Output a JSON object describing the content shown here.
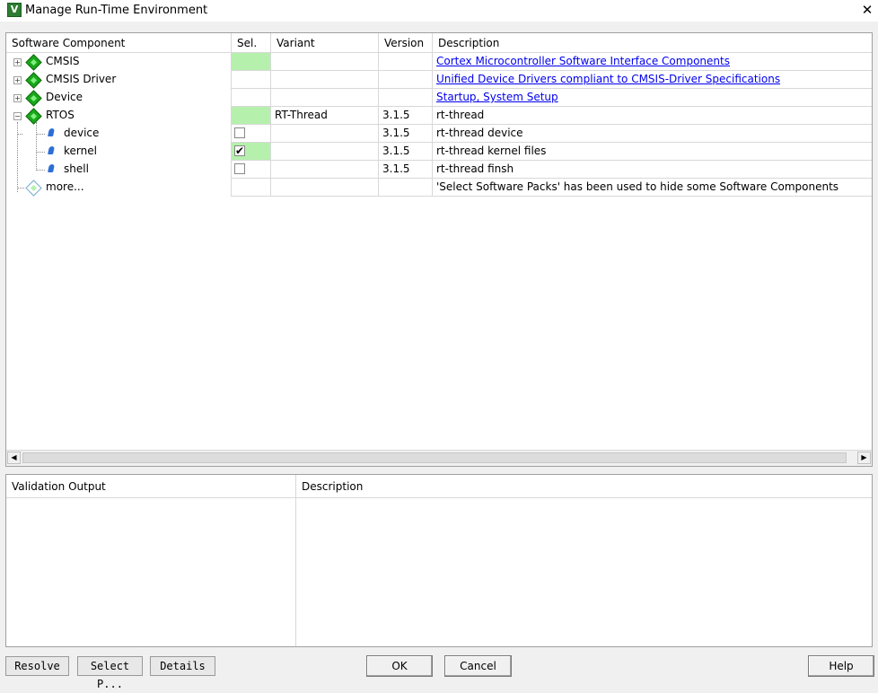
{
  "window": {
    "title": "Manage Run-Time Environment",
    "app_icon": "V",
    "close_glyph": "✕"
  },
  "table": {
    "headers": {
      "component": "Software Component",
      "sel": "Sel.",
      "variant": "Variant",
      "version": "Version",
      "description": "Description"
    },
    "rows": [
      {
        "component": "CMSIS",
        "variant": "",
        "version": "",
        "description": "Cortex Microcontroller Software Interface Components"
      },
      {
        "component": "CMSIS Driver",
        "variant": "",
        "version": "",
        "description": "Unified Device Drivers compliant to CMSIS-Driver Specifications"
      },
      {
        "component": "Device",
        "variant": "",
        "version": "",
        "description": "Startup, System Setup"
      },
      {
        "component": "RTOS",
        "variant": "RT-Thread",
        "version": "3.1.5",
        "description": "rt-thread"
      },
      {
        "component": "device",
        "variant": "",
        "version": "3.1.5",
        "description": "rt-thread device",
        "checked": false
      },
      {
        "component": "kernel",
        "variant": "",
        "version": "3.1.5",
        "description": "rt-thread kernel files",
        "checked": true
      },
      {
        "component": "shell",
        "variant": "",
        "version": "3.1.5",
        "description": "rt-thread finsh",
        "checked": false
      },
      {
        "component": "more...",
        "variant": "",
        "version": "",
        "description": "'Select Software Packs' has been used to hide some Software Components"
      }
    ],
    "check_glyph": "✔"
  },
  "scrollbar": {
    "left_arrow": "◀",
    "right_arrow": "▶"
  },
  "validation": {
    "output_header": "Validation Output",
    "description_header": "Description"
  },
  "buttons": {
    "resolve": "Resolve",
    "select_packs": "Select P...",
    "details": "Details",
    "ok": "OK",
    "cancel": "Cancel",
    "help": "Help"
  },
  "colors": {
    "selection_green": "#b6f0ad",
    "link_blue": "#0000ee"
  }
}
